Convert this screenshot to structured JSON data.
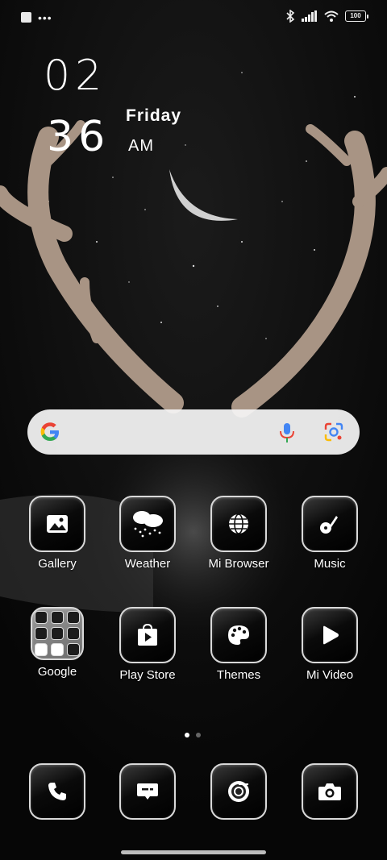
{
  "status_bar": {
    "battery": "100"
  },
  "clock": {
    "hour": "02",
    "minute": "36",
    "day": "Friday",
    "ampm": "AM"
  },
  "apps_row1": [
    {
      "label": "Gallery",
      "icon": "image-icon"
    },
    {
      "label": "Weather",
      "icon": "cloud-rain-icon"
    },
    {
      "label": "Mi Browser",
      "icon": "globe-icon"
    },
    {
      "label": "Music",
      "icon": "music-note-icon"
    }
  ],
  "apps_row2": [
    {
      "label": "Google",
      "icon": "folder-icon"
    },
    {
      "label": "Play Store",
      "icon": "play-store-icon"
    },
    {
      "label": "Themes",
      "icon": "palette-icon"
    },
    {
      "label": "Mi Video",
      "icon": "play-icon"
    }
  ],
  "dock": [
    {
      "icon": "phone-icon"
    },
    {
      "icon": "messages-icon"
    },
    {
      "icon": "chrome-icon"
    },
    {
      "icon": "camera-icon"
    }
  ],
  "page_indicator": {
    "pages": 2,
    "current": 1
  },
  "colors": {
    "background": "#050505",
    "icon_border": "#d9d9d9",
    "search_bg": "#f5f5f5"
  }
}
